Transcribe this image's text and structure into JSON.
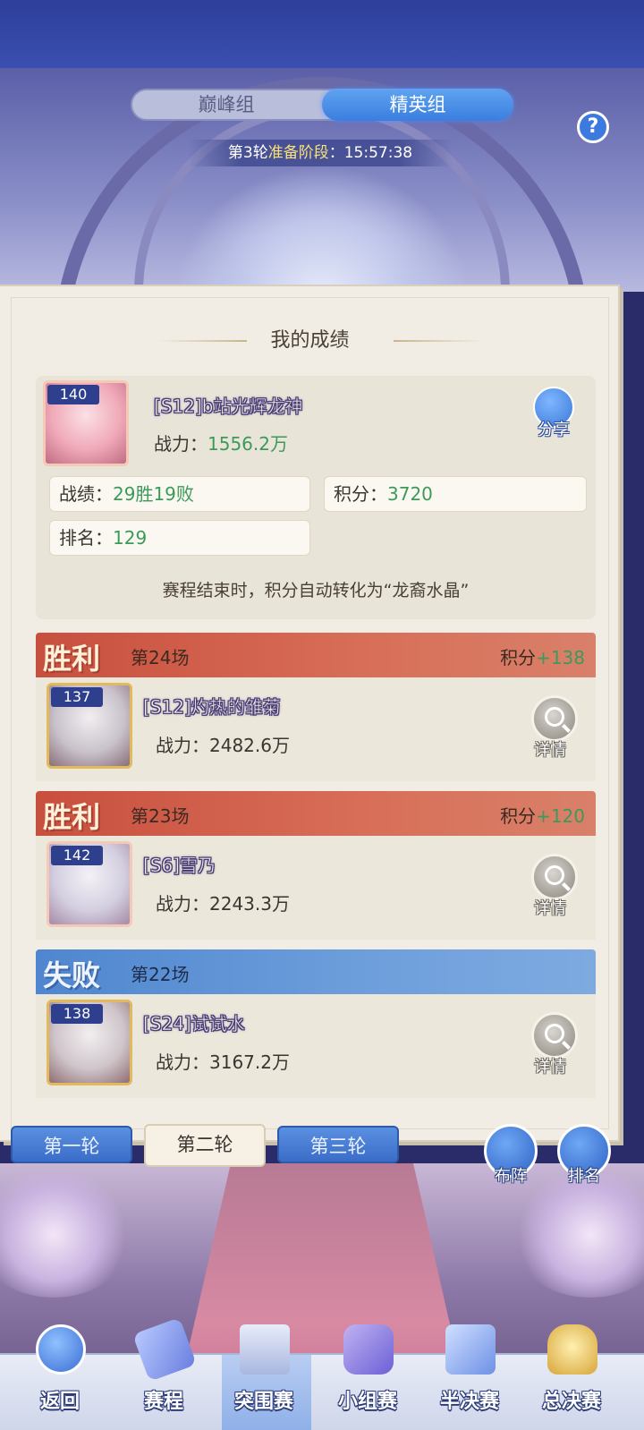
{
  "group_tabs": {
    "left": "巅峰组",
    "right": "精英组",
    "selected": "精英组"
  },
  "stage": {
    "round": "第3轮",
    "phase": "准备阶段",
    "timer": "15:57:38"
  },
  "help_label": "?",
  "my_record": {
    "title": "我的成绩",
    "level": "140",
    "name": "[S12]b站光辉龙神",
    "power_label": "战力：",
    "power": "1556.2万",
    "share_label": "分享",
    "record_label": "战绩：",
    "record": "29胜19败",
    "points_label": "积分：",
    "points": "3720",
    "rank_label": "排名：",
    "rank": "129",
    "note": "赛程结束时，积分自动转化为“龙裔水晶”"
  },
  "matches": [
    {
      "result": "胜利",
      "match_no": "第24场",
      "score_label": "积分",
      "score": "+138",
      "level": "137",
      "opponent": "[S12]灼热的雏菊",
      "power_label": "战力：",
      "power": "2482.6万",
      "detail": "详情"
    },
    {
      "result": "胜利",
      "match_no": "第23场",
      "score_label": "积分",
      "score": "+120",
      "level": "142",
      "opponent": "[S6]雪乃",
      "power_label": "战力：",
      "power": "2243.3万",
      "detail": "详情"
    },
    {
      "result": "失败",
      "match_no": "第22场",
      "level": "138",
      "opponent": "[S24]试试水",
      "power_label": "战力：",
      "power": "3167.2万",
      "detail": "详情"
    }
  ],
  "round_tabs": [
    "第一轮",
    "第二轮",
    "第三轮"
  ],
  "selected_round": "第二轮",
  "side_buttons": {
    "formation": "布阵",
    "ranking": "排名"
  },
  "bottom_nav": [
    "返回",
    "赛程",
    "突围赛",
    "小组赛",
    "半决赛",
    "总决赛"
  ],
  "active_nav": "突围赛",
  "colors": {
    "win": "#c84f3e",
    "lose": "#4f86cf",
    "accent_green": "#3b9a5a",
    "tab_blue": "#3a7ee0"
  }
}
